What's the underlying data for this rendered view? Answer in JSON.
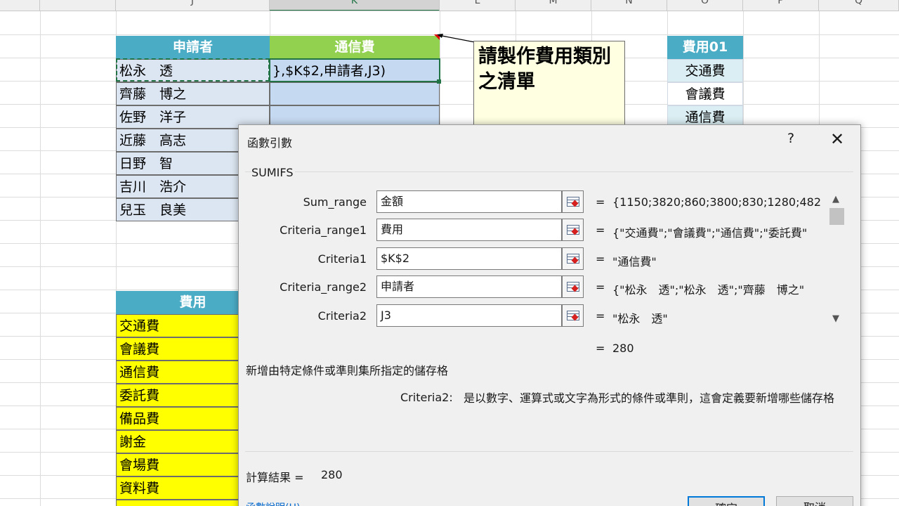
{
  "sheet": {
    "columns": [
      "J",
      "K",
      "L",
      "M",
      "N",
      "O",
      "P",
      "Q"
    ],
    "applicant_header": "申請者",
    "telecom_header": "通信費",
    "formula_text": "},$K$2,申請者,J3)",
    "applicants": [
      "松永　透",
      "齊藤　博之",
      "佐野　洋子",
      "近藤　高志",
      "日野　智",
      "吉川　浩介",
      "兒玉　良美"
    ],
    "expense_header": "費用",
    "expense_items": [
      "交通費",
      "會議費",
      "通信費",
      "委託費",
      "備品費",
      "謝金",
      "會場費",
      "資料費"
    ],
    "list_header": "費用01",
    "list_items": [
      "交通費",
      "會議費",
      "通信費"
    ],
    "comment_text": "請製作費用類別之清單",
    "colors": {
      "blue_header": "#4bacc6",
      "green_header": "#92d050",
      "yellow": "#ffff00",
      "selection": "#217346"
    }
  },
  "dialog": {
    "title": "函數引數",
    "help_label": "?",
    "close_label": "✕",
    "function_name": "SUMIFS",
    "args": [
      {
        "label": "Sum_range",
        "input": "金額",
        "value": "{1150;3820;860;3800;830;1280;482"
      },
      {
        "label": "Criteria_range1",
        "input": "費用",
        "value": "{\"交通費\";\"會議費\";\"通信費\";\"委託費\""
      },
      {
        "label": "Criteria1",
        "input": "$K$2",
        "value": "\"通信費\""
      },
      {
        "label": "Criteria_range2",
        "input": "申請者",
        "value": "{\"松永　透\";\"松永　透\";\"齊藤　博之\""
      },
      {
        "label": "Criteria2",
        "input": "J3",
        "value": "\"松永　透\""
      }
    ],
    "equals": "=",
    "formula_result": "280",
    "description": "新增由特定條件或準則集所指定的儲存格",
    "arg_desc_label": "Criteria2:",
    "arg_desc_text": "是以數字、運算式或文字為形式的條件或準則，這會定義要新增哪些儲存格",
    "calc_label": "計算結果 =",
    "calc_value": "280",
    "help_link": "函數說明(H)",
    "ok_label": "確定",
    "cancel_label": "取消"
  }
}
